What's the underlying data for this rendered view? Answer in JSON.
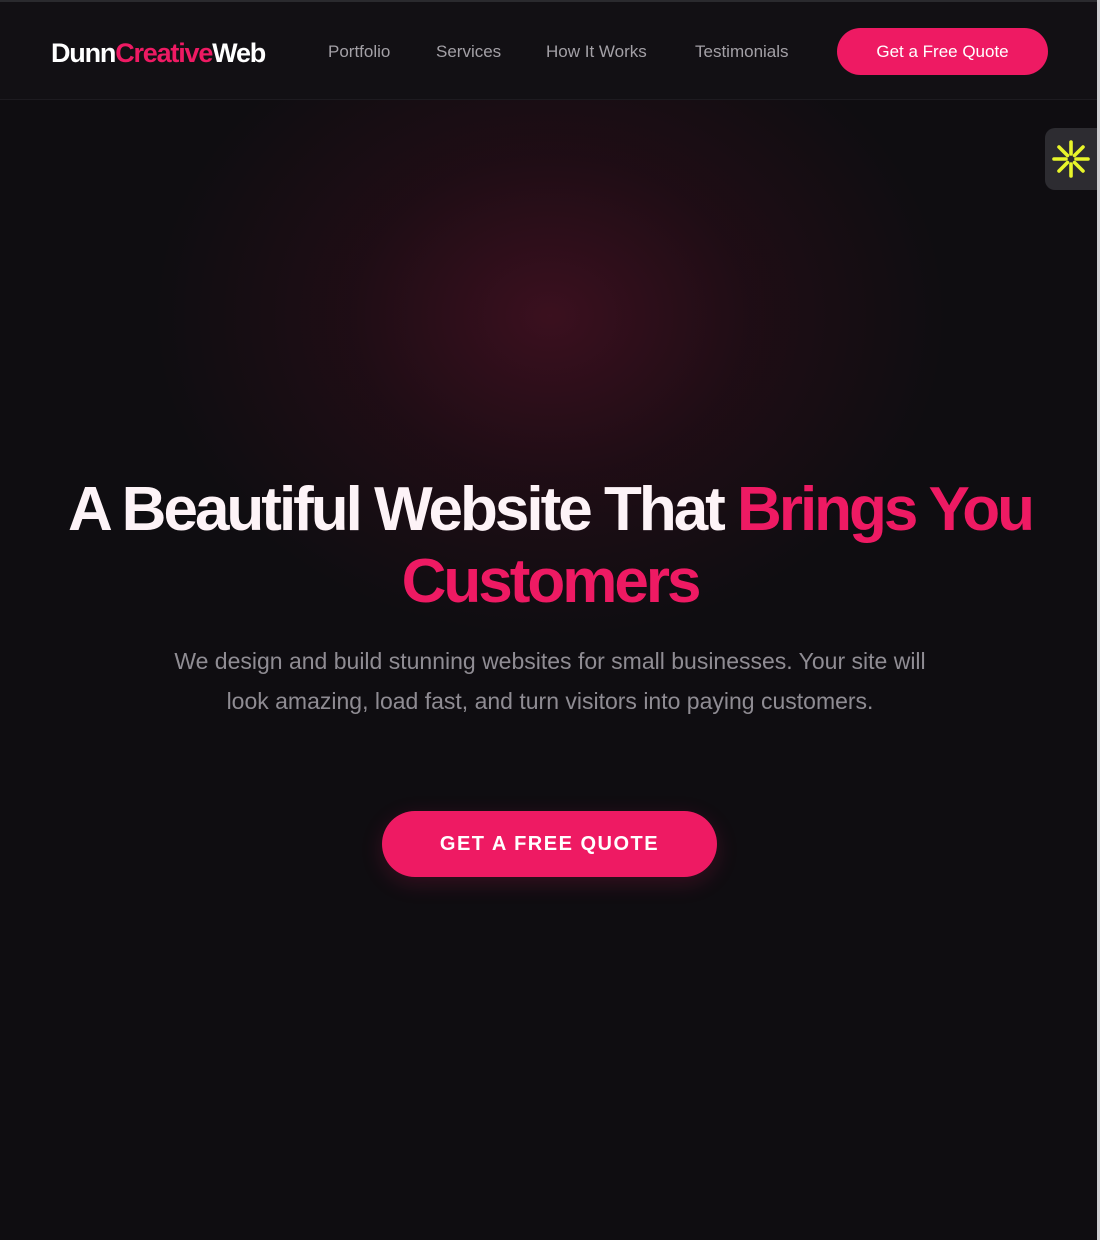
{
  "brand": {
    "logo_part1": "Dunn",
    "logo_part2": "Creative",
    "logo_part3": "Web"
  },
  "nav": {
    "items": [
      {
        "label": "Portfolio"
      },
      {
        "label": "Services"
      },
      {
        "label": "How It Works"
      },
      {
        "label": "Testimonials"
      }
    ],
    "cta_label": "Get a Free Quote"
  },
  "hero": {
    "title_main": "A Beautiful Website That ",
    "title_accent": "Brings You Customers",
    "subtitle": "We design and build stunning websites for small businesses. Your site will look amazing, load fast, and turn visitors into paying customers.",
    "cta_label": "GET A FREE QUOTE"
  },
  "widget": {
    "icon": "sparkle-burst-icon"
  },
  "colors": {
    "background": "#0f0d11",
    "navbar": "#121014",
    "accent": "#ee1a63",
    "nav_text": "#a3a0a6",
    "subtitle_text": "#8f8c93",
    "widget_icon": "#e8f52a"
  }
}
